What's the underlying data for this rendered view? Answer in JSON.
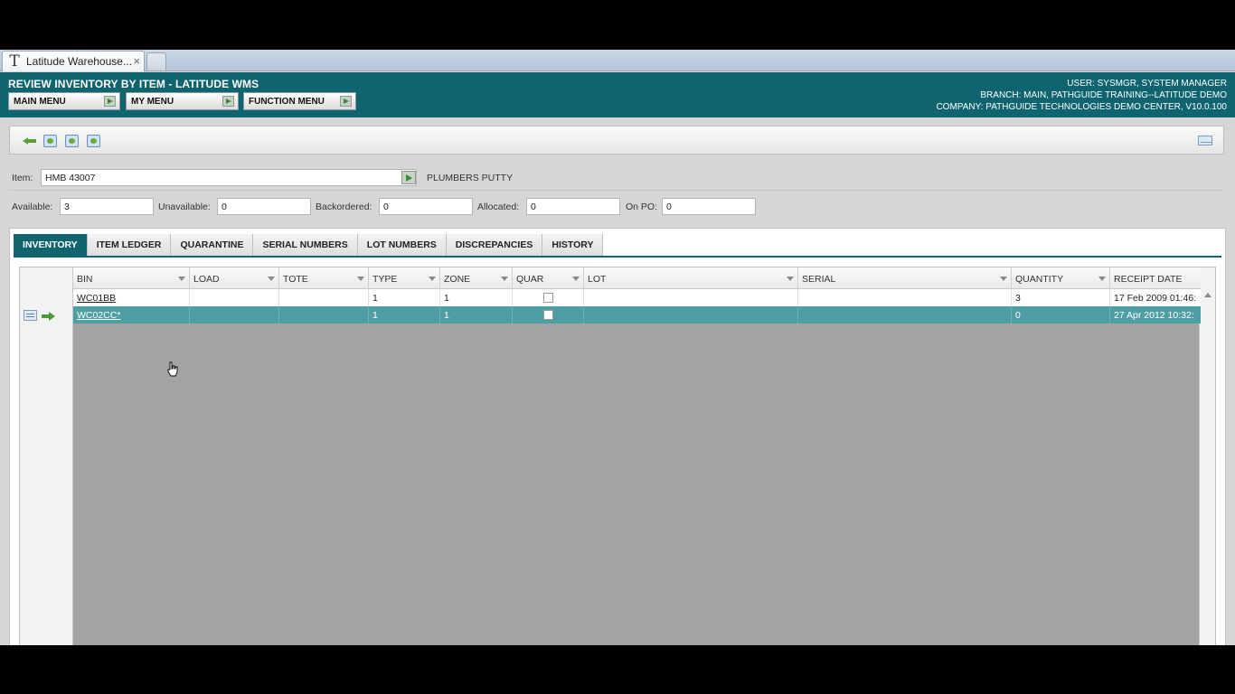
{
  "browser": {
    "tab_title": "Latitude Warehouse...",
    "tab_logo": "T",
    "tab_close": "×"
  },
  "header": {
    "title": "REVIEW INVENTORY BY ITEM - LATITUDE WMS",
    "menus": [
      "MAIN MENU",
      "MY MENU",
      "FUNCTION MENU"
    ],
    "user": "USER: SYSMGR, SYSTEM MANAGER",
    "branch": "BRANCH: MAIN, PATHGUIDE TRAINING--LATITUDE DEMO",
    "company": "COMPANY: PATHGUIDE TECHNOLOGIES DEMO CENTER, V10.0.100"
  },
  "toolbar": {
    "icons": [
      "back-arrow-icon",
      "refresh-doc-icon",
      "next-doc-icon",
      "reload-doc-icon",
      "mail-icon"
    ]
  },
  "item": {
    "label": "Item:",
    "value": "HMB 43007",
    "description": "PLUMBERS PUTTY"
  },
  "quantities": [
    {
      "label": "Available:",
      "value": "3"
    },
    {
      "label": "Unavailable:",
      "value": "0"
    },
    {
      "label": "Backordered:",
      "value": "0"
    },
    {
      "label": "Allocated:",
      "value": "0"
    },
    {
      "label": "On PO:",
      "value": "0"
    }
  ],
  "tabs": [
    "INVENTORY",
    "ITEM LEDGER",
    "QUARANTINE",
    "SERIAL NUMBERS",
    "LOT NUMBERS",
    "DISCREPANCIES",
    "HISTORY"
  ],
  "active_tab": "INVENTORY",
  "grid": {
    "columns": [
      "BIN",
      "LOAD",
      "TOTE",
      "TYPE",
      "ZONE",
      "QUAR",
      "LOT",
      "SERIAL",
      "QUANTITY",
      "RECEIPT DATE"
    ],
    "rows": [
      {
        "bin": "WC01BB",
        "load": "",
        "tote": "",
        "type": "1",
        "zone": "1",
        "quar": false,
        "lot": "",
        "serial": "",
        "quantity": "3",
        "receipt_date": "17 Feb 2009 01:46:",
        "selected": false
      },
      {
        "bin": "WC02CC*",
        "load": "",
        "tote": "",
        "type": "1",
        "zone": "1",
        "quar": false,
        "lot": "",
        "serial": "",
        "quantity": "0",
        "receipt_date": "27 Apr 2012 10:32:",
        "selected": true
      }
    ]
  },
  "colors": {
    "header_bg": "#0f6470",
    "selected_row": "#4f9ea4",
    "grid_empty": "#a3a3a3"
  }
}
